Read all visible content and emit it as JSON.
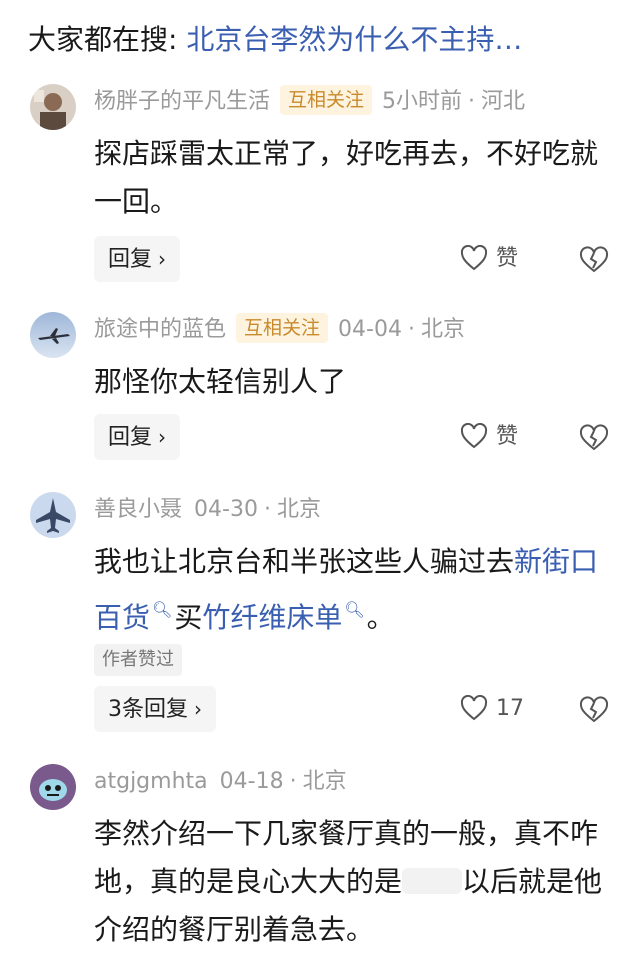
{
  "search": {
    "label": "大家都在搜:",
    "query": "北京台李然为什么不主持…"
  },
  "comments": [
    {
      "username": "杨胖子的平凡生活",
      "badge": "互相关注",
      "time": "5小时前",
      "location": "河北",
      "text": "探店踩雷太正常了，好吃再去，不好吃就一回。",
      "reply_label": "回复",
      "like_label": "赞"
    },
    {
      "username": "旅途中的蓝色",
      "badge": "互相关注",
      "time": "04-04",
      "location": "北京",
      "text": "那怪你太轻信别人了",
      "reply_label": "回复",
      "like_label": "赞"
    },
    {
      "username": "善良小聂",
      "time": "04-30",
      "location": "北京",
      "text_before": "我也让北京台和半张这些人骗过去",
      "link1": "新街口百货",
      "text_between": "买",
      "link2": "竹纤维床单",
      "text_after": "。",
      "author_liked": "作者赞过",
      "reply_label": "3条回复",
      "like_count": "17"
    },
    {
      "username": "atgjgmhta",
      "time": "04-18",
      "location": "北京",
      "text_before": "李然介绍一下几家餐厅真的一般，真不咋地，真的是良心大大的是",
      "text_after": "以后就是他介绍的餐厅别着急去。"
    }
  ],
  "colors": {
    "link": "#3b5fb0",
    "badge_bg": "#fdf3df",
    "badge_text": "#c98a2b",
    "meta": "#9a9a9a"
  },
  "icons": [
    "heart-outline-icon",
    "broken-heart-icon",
    "chevron-right-icon",
    "search-icon"
  ]
}
